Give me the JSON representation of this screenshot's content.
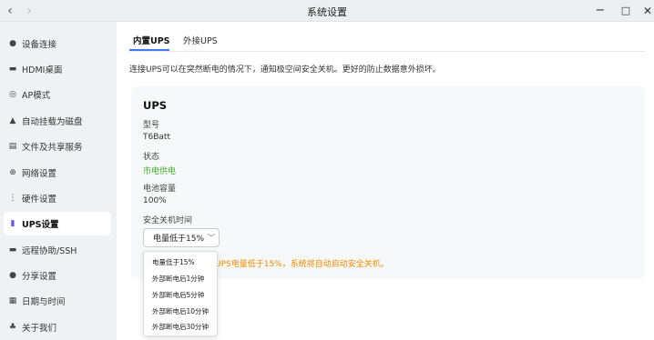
{
  "window": {
    "title": "系统设置",
    "back_icon": "‹",
    "forward_icon": "›",
    "minimize_icon": "−",
    "maximize_icon": "□",
    "close_icon": "✕"
  },
  "sidebar": {
    "items": [
      {
        "label": "设备连接",
        "icon": "●"
      },
      {
        "label": "HDMI桌面",
        "icon": "▬"
      },
      {
        "label": "AP模式",
        "icon": "◎"
      },
      {
        "label": "自动挂载为磁盘",
        "icon": "▲"
      },
      {
        "label": "文件及共享服务",
        "icon": "▤"
      },
      {
        "label": "网络设置",
        "icon": "⊕"
      },
      {
        "label": "硬件设置",
        "icon": "⋮"
      },
      {
        "label": "UPS设置",
        "icon": "▮"
      },
      {
        "label": "远程协助/SSH",
        "icon": "▬"
      },
      {
        "label": "分享设置",
        "icon": "●"
      },
      {
        "label": "日期与时间",
        "icon": "▦"
      },
      {
        "label": "关于我们",
        "icon": "♣"
      }
    ],
    "active_index": 7
  },
  "tabs": {
    "internal": "内置UPS",
    "external": "外接UPS"
  },
  "description": "连接UPS可以在突然断电的情况下，通知极空间安全关机。更好的防止数据意外损坏。",
  "ups": {
    "title": "UPS",
    "model_label": "型号",
    "model_value": "T6Batt",
    "status_label": "状态",
    "status_value": "市电供电",
    "battery_label": "电池容量",
    "battery_value": "100%",
    "shutdown_label": "安全关机时间",
    "shutdown_selected": "电量低于15%",
    "chevron": "﹀",
    "warning": "UPS电量低于15%，系统将自动启动安全关机。"
  },
  "dropdown_options": [
    "电量低于15%",
    "外部断电后1分钟",
    "外部断电后5分钟",
    "外部断电后10分钟",
    "外部断电后30分钟"
  ],
  "colors": {
    "accent": "#3d7bff",
    "status_green": "#3fa92b",
    "warning_orange": "#f08a00",
    "active_icon": "#6b5bd6"
  }
}
